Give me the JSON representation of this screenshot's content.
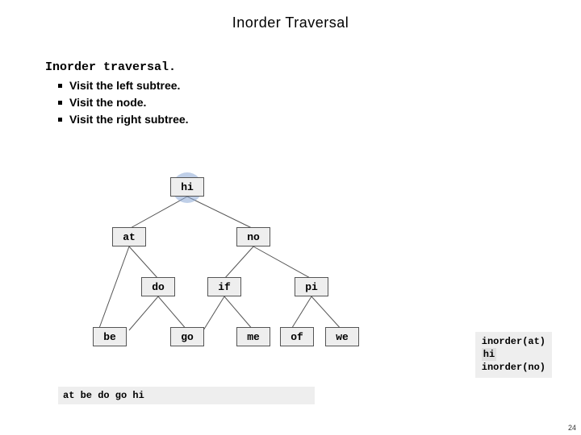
{
  "title": "Inorder Traversal",
  "section": {
    "heading": "Inorder traversal.",
    "bullets": [
      "Visit the left subtree.",
      "Visit the node.",
      "Visit the right subtree."
    ]
  },
  "tree": {
    "highlighted": "hi",
    "nodes": {
      "hi": "hi",
      "at": "at",
      "no": "no",
      "do": "do",
      "if": "if",
      "pi": "pi",
      "be": "be",
      "go": "go",
      "me": "me",
      "of": "of",
      "we": "we"
    }
  },
  "trace": {
    "lines": [
      "inorder(at)",
      "hi",
      "inorder(no)"
    ],
    "current_line_index": 1
  },
  "output": "at be do go hi",
  "page_number": "24"
}
